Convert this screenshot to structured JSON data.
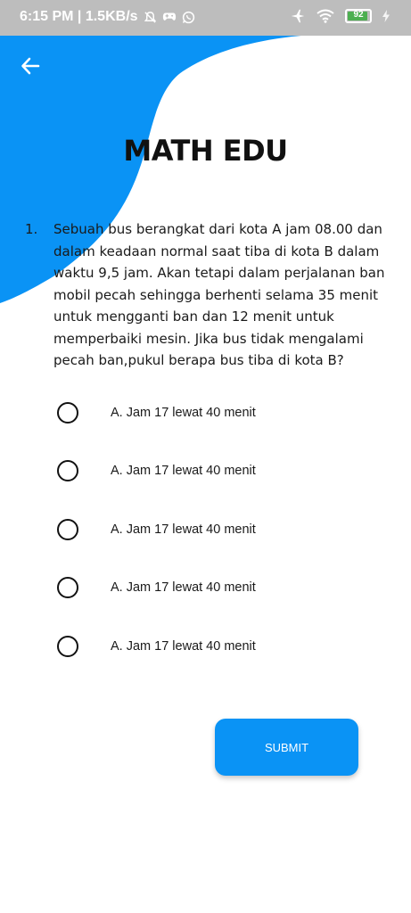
{
  "status_bar": {
    "time_speed": "6:15 PM | 1.5KB/s",
    "battery_level": "92",
    "icons": [
      "mute-bell-icon",
      "game-controller-icon",
      "whatsapp-icon",
      "airplane-mode-icon",
      "wifi-icon",
      "battery-icon",
      "charging-bolt-icon"
    ]
  },
  "header": {
    "title": "MATH EDU",
    "back_icon": "arrow-left-icon"
  },
  "question": {
    "number": "1.",
    "text": "Sebuah bus berangkat dari kota A jam 08.00 dan dalam keadaan normal saat tiba di kota B dalam waktu 9,5 jam. Akan tetapi dalam perjalanan ban mobil pecah sehingga berhenti selama 35 menit untuk mengganti ban dan 12 menit untuk memperbaiki mesin. Jika bus tidak mengalami pecah ban,pukul berapa bus tiba di kota B?"
  },
  "options": [
    {
      "label": "A. Jam 17 lewat 40 menit"
    },
    {
      "label": "A. Jam 17 lewat 40 menit"
    },
    {
      "label": "A. Jam 17 lewat 40 menit"
    },
    {
      "label": "A. Jam 17 lewat 40 menit"
    },
    {
      "label": "A. Jam 17 lewat 40 menit"
    }
  ],
  "submit": {
    "label": "SUBMIT"
  },
  "colors": {
    "accent": "#0a93f5",
    "status_bar": "#bdbdbd",
    "battery": "#4caf50"
  }
}
